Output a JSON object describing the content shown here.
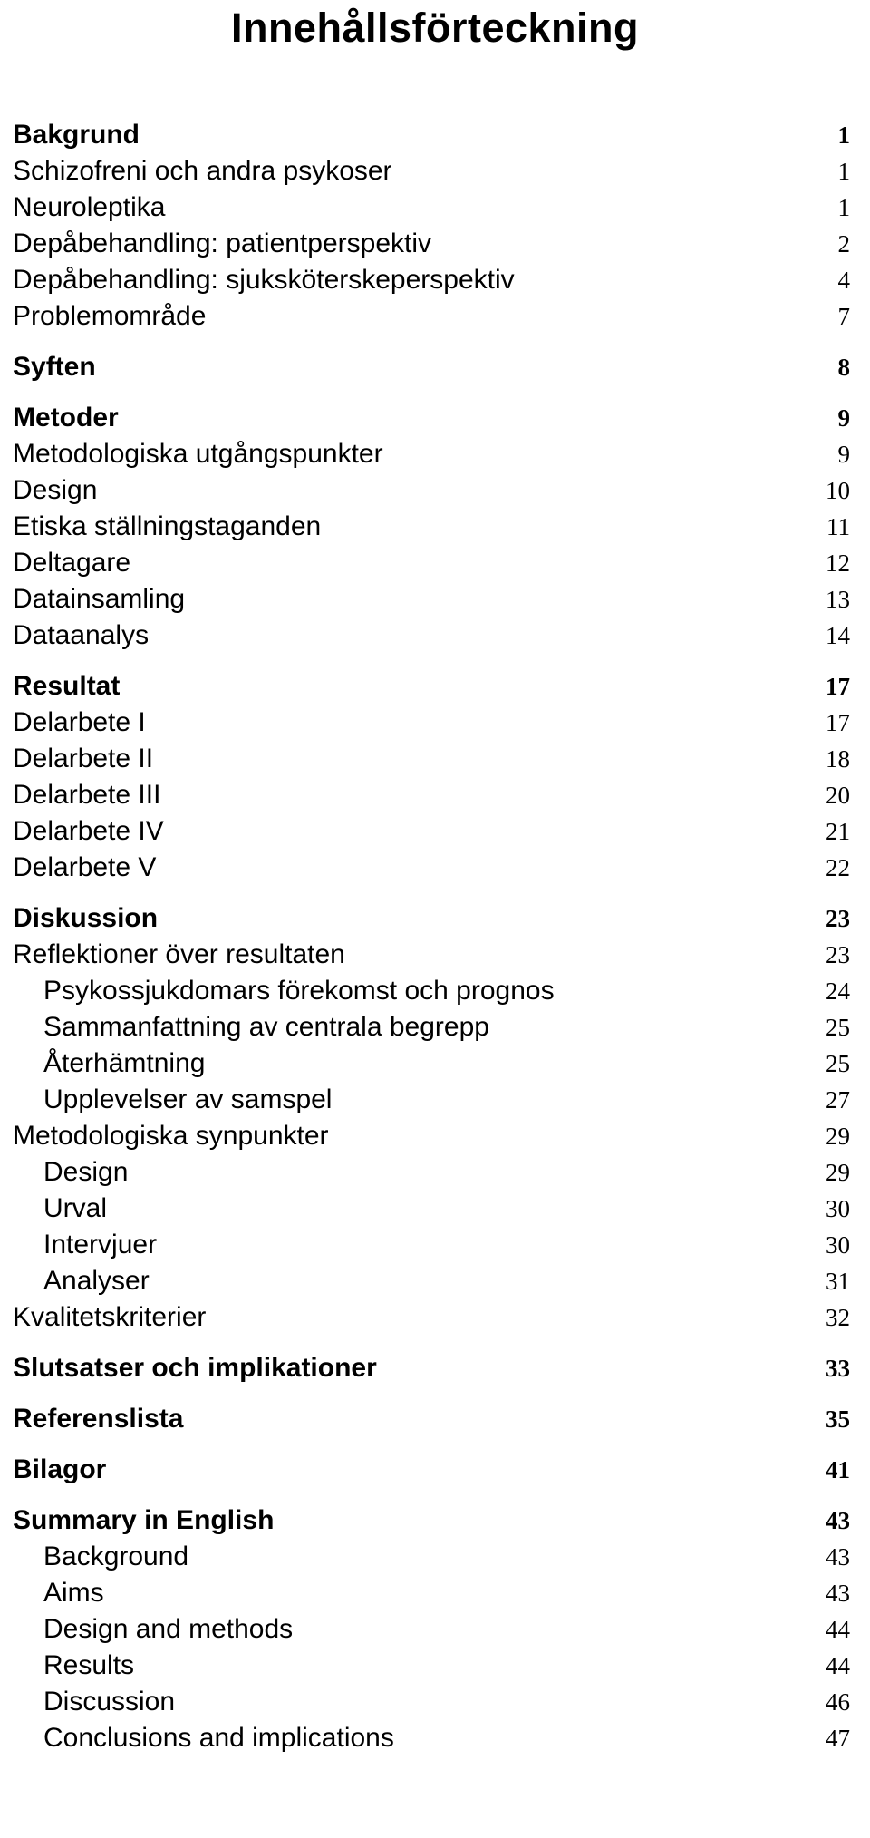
{
  "document": {
    "title": "Innehållsförteckning"
  },
  "toc": {
    "entries": [
      {
        "label": "Bakgrund",
        "page": "1",
        "level": "heading",
        "indent": 0,
        "space_before": 0
      },
      {
        "label": "Schizofreni och andra psykoser",
        "page": "1",
        "level": "sub",
        "indent": 0,
        "space_before": 0
      },
      {
        "label": "Neuroleptika",
        "page": "1",
        "level": "sub",
        "indent": 0,
        "space_before": 0
      },
      {
        "label": "Depåbehandling: patientperspektiv",
        "page": "2",
        "level": "sub",
        "indent": 0,
        "space_before": 0
      },
      {
        "label": "Depåbehandling: sjuksköterskeperspektiv",
        "page": "4",
        "level": "sub",
        "indent": 0,
        "space_before": 0
      },
      {
        "label": "Problemområde",
        "page": "7",
        "level": "sub",
        "indent": 0,
        "space_before": 0
      },
      {
        "label": "Syften",
        "page": "8",
        "level": "heading",
        "indent": 0,
        "space_before": 16
      },
      {
        "label": "Metoder",
        "page": "9",
        "level": "heading",
        "indent": 0,
        "space_before": 16
      },
      {
        "label": "Metodologiska utgångspunkter",
        "page": "9",
        "level": "sub",
        "indent": 0,
        "space_before": 0
      },
      {
        "label": "Design",
        "page": "10",
        "level": "sub",
        "indent": 0,
        "space_before": 0
      },
      {
        "label": "Etiska ställningstaganden",
        "page": "11",
        "level": "sub",
        "indent": 0,
        "space_before": 0
      },
      {
        "label": "Deltagare",
        "page": "12",
        "level": "sub",
        "indent": 0,
        "space_before": 0
      },
      {
        "label": "Datainsamling",
        "page": "13",
        "level": "sub",
        "indent": 0,
        "space_before": 0
      },
      {
        "label": "Dataanalys",
        "page": "14",
        "level": "sub",
        "indent": 0,
        "space_before": 0
      },
      {
        "label": "Resultat",
        "page": "17",
        "level": "heading",
        "indent": 0,
        "space_before": 16
      },
      {
        "label": "Delarbete I",
        "page": "17",
        "level": "sub",
        "indent": 0,
        "space_before": 0
      },
      {
        "label": "Delarbete II",
        "page": "18",
        "level": "sub",
        "indent": 0,
        "space_before": 0
      },
      {
        "label": "Delarbete III",
        "page": "20",
        "level": "sub",
        "indent": 0,
        "space_before": 0
      },
      {
        "label": "Delarbete IV",
        "page": "21",
        "level": "sub",
        "indent": 0,
        "space_before": 0
      },
      {
        "label": "Delarbete V",
        "page": "22",
        "level": "sub",
        "indent": 0,
        "space_before": 0
      },
      {
        "label": "Diskussion",
        "page": "23",
        "level": "heading",
        "indent": 0,
        "space_before": 16
      },
      {
        "label": "Reflektioner över resultaten",
        "page": "23",
        "level": "sub",
        "indent": 0,
        "space_before": 0
      },
      {
        "label": "Psykossjukdomars förekomst och prognos",
        "page": "24",
        "level": "sub",
        "indent": 1,
        "space_before": 0
      },
      {
        "label": "Sammanfattning av centrala begrepp",
        "page": "25",
        "level": "sub",
        "indent": 1,
        "space_before": 0
      },
      {
        "label": "Återhämtning",
        "page": "25",
        "level": "sub",
        "indent": 1,
        "space_before": 0
      },
      {
        "label": "Upplevelser av samspel",
        "page": "27",
        "level": "sub",
        "indent": 1,
        "space_before": 0
      },
      {
        "label": "Metodologiska synpunkter",
        "page": "29",
        "level": "sub",
        "indent": 0,
        "space_before": 0
      },
      {
        "label": "Design",
        "page": "29",
        "level": "sub",
        "indent": 1,
        "space_before": 0
      },
      {
        "label": "Urval",
        "page": "30",
        "level": "sub",
        "indent": 1,
        "space_before": 0
      },
      {
        "label": "Intervjuer",
        "page": "30",
        "level": "sub",
        "indent": 1,
        "space_before": 0
      },
      {
        "label": "Analyser",
        "page": "31",
        "level": "sub",
        "indent": 1,
        "space_before": 0
      },
      {
        "label": "Kvalitetskriterier",
        "page": "32",
        "level": "sub",
        "indent": 0,
        "space_before": 0
      },
      {
        "label": "Slutsatser och implikationer",
        "page": "33",
        "level": "heading",
        "indent": 0,
        "space_before": 16
      },
      {
        "label": "Referenslista",
        "page": "35",
        "level": "heading",
        "indent": 0,
        "space_before": 16
      },
      {
        "label": "Bilagor",
        "page": "41",
        "level": "heading",
        "indent": 0,
        "space_before": 16
      },
      {
        "label": "Summary in English",
        "page": "43",
        "level": "heading",
        "indent": 0,
        "space_before": 16
      },
      {
        "label": "Background",
        "page": "43",
        "level": "sub",
        "indent": 1,
        "space_before": 0
      },
      {
        "label": "Aims",
        "page": "43",
        "level": "sub",
        "indent": 1,
        "space_before": 0
      },
      {
        "label": "Design and methods",
        "page": "44",
        "level": "sub",
        "indent": 1,
        "space_before": 0
      },
      {
        "label": "Results",
        "page": "44",
        "level": "sub",
        "indent": 1,
        "space_before": 0
      },
      {
        "label": "Discussion",
        "page": "46",
        "level": "sub",
        "indent": 1,
        "space_before": 0
      },
      {
        "label": "Conclusions and implications",
        "page": "47",
        "level": "sub",
        "indent": 1,
        "space_before": 0
      }
    ]
  }
}
